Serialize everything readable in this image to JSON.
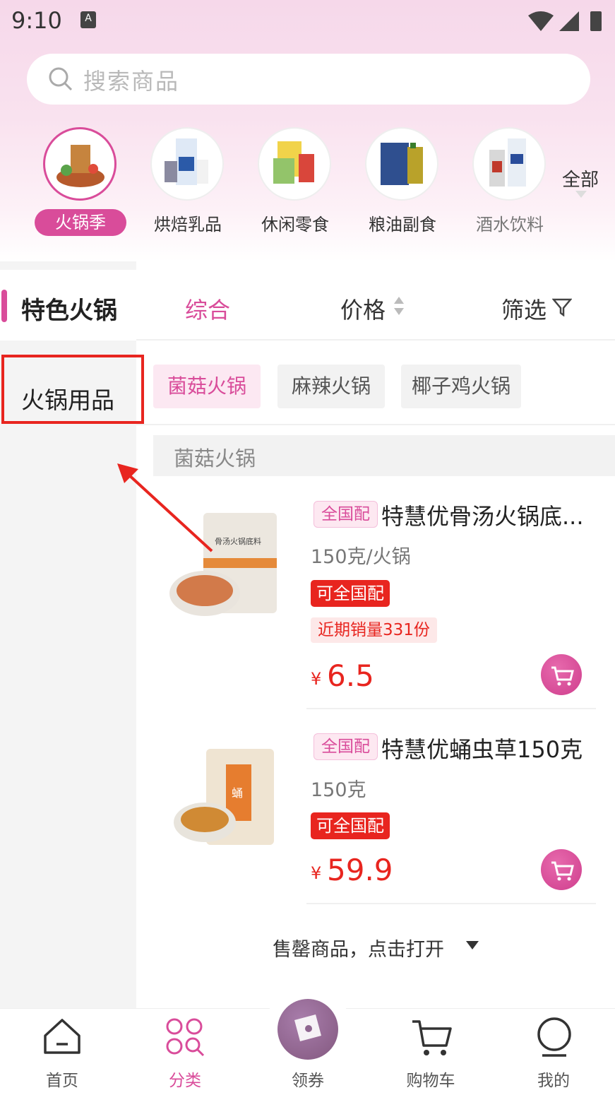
{
  "status_bar": {
    "time": "9:10",
    "notif": "A"
  },
  "search": {
    "placeholder": "搜索商品"
  },
  "categories": [
    {
      "label": "火锅季",
      "active": true
    },
    {
      "label": "烘焙乳品"
    },
    {
      "label": "休闲零食"
    },
    {
      "label": "粮油副食"
    },
    {
      "label": "酒水饮料"
    }
  ],
  "all_label": "全部",
  "sidebar": {
    "items": [
      {
        "label": "特色火锅",
        "active": true
      },
      {
        "label": "火锅用品"
      }
    ]
  },
  "sort_bar": {
    "comprehensive": "综合",
    "price": "价格",
    "filter": "筛选"
  },
  "sub_tags": [
    "菌菇火锅",
    "麻辣火锅",
    "椰子鸡火锅"
  ],
  "section": {
    "title": "菌菇火锅"
  },
  "products": [
    {
      "badge": "全国配",
      "title": "特慧优骨汤火锅底...",
      "spec": "150克/火锅",
      "tag": "可全国配",
      "sales": "近期销量331份",
      "currency": "¥",
      "price": "6.5"
    },
    {
      "badge": "全国配",
      "title": "特慧优蛹虫草150克",
      "spec": "150克",
      "tag": "可全国配",
      "currency": "¥",
      "price": "59.9"
    }
  ],
  "soldout_toggle": "售罄商品，点击打开",
  "tabbar": {
    "home": "首页",
    "category": "分类",
    "coupon": "领券",
    "cart": "购物车",
    "mine": "我的"
  },
  "colors": {
    "accent": "#d94c9a",
    "price_red": "#e8251f",
    "annotation_red": "#e8251f"
  }
}
